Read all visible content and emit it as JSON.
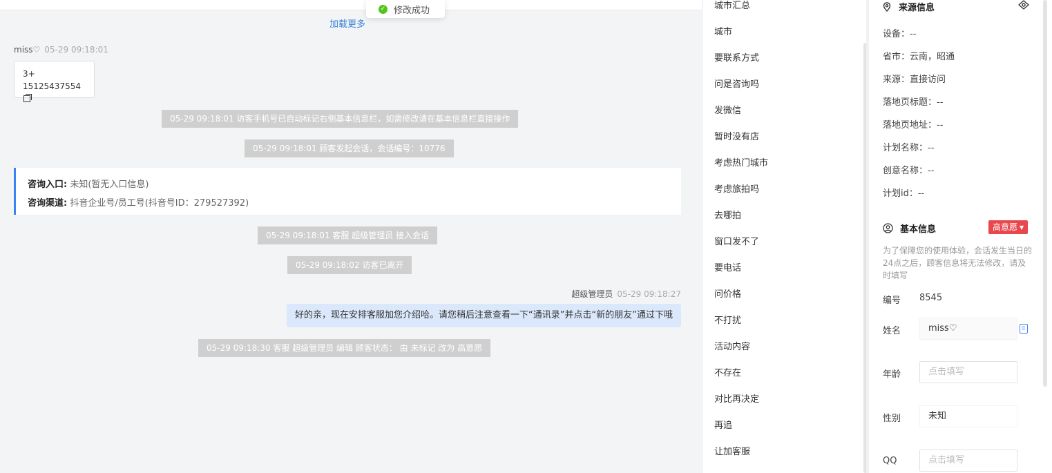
{
  "toast": {
    "text": "修改成功"
  },
  "chat": {
    "load_more": "加载更多",
    "visitor": {
      "name": "miss♡",
      "time": "05-29 09:18:01",
      "line1": "3+",
      "line2": "15125437554"
    },
    "system_1": "05-29 09:18:01 访客手机号已自动标记右侧基本信息栏，如需修改请在基本信息栏直接操作",
    "system_2": "05-29 09:18:01 顾客发起会话，会话编号：10776",
    "entry": {
      "label1": "咨询入口:",
      "value1": "未知(暂无入口信息)",
      "label2": "咨询渠道:",
      "value2": "抖音企业号/员工号(抖音号ID：279527392)"
    },
    "system_3": "05-29 09:18:01 客服 超级管理员 接入会话",
    "system_4": "05-29 09:18:02 访客已离开",
    "agent": {
      "name": "超级管理员",
      "time": "05-29 09:18:27",
      "text": "好的亲，现在安排客服加您介绍哈。请您稍后注意查看一下“通讯录”并点击“新的朋友”通过下哦"
    },
    "system_5": "05-29 09:18:30 客服 超级管理员 编辑 顾客状态： 由 未标记 改为 高意愿"
  },
  "phrases": [
    "城市汇总",
    "城市",
    "要联系方式",
    "问是咨询吗",
    "发微信",
    "暂时没有店",
    "考虑热门城市",
    "考虑旅拍吗",
    "去哪拍",
    "窗口发不了",
    "要电话",
    "问价格",
    "不打扰",
    "活动内容",
    "不存在",
    "对比再决定",
    "再追",
    "让加客服"
  ],
  "source": {
    "title": "来源信息",
    "device": "设备：--",
    "province": "省市：云南，昭通",
    "from": "来源：直接访问",
    "landing_title": "落地页标题：--",
    "landing_url": "落地页地址：--",
    "plan_name": "计划名称：--",
    "creative_name": "创意名称：--",
    "plan_id": "计划id：--"
  },
  "basic": {
    "title": "基本信息",
    "intent": "高意愿",
    "note": "为了保障您的使用体验，会话发生当日的24点之后，顾客信息将无法修改，请及时填写",
    "number_label": "编号",
    "number_value": "8545",
    "name_label": "姓名",
    "name_value": "miss♡",
    "age_label": "年龄",
    "age_placeholder": "点击填写",
    "gender_label": "性别",
    "gender_value": "未知",
    "qq_label": "QQ",
    "qq_placeholder": "点击填写"
  },
  "colors": {
    "accent": "#3b82f6",
    "intent_badge": "#e8474d",
    "success": "#52c41a"
  }
}
